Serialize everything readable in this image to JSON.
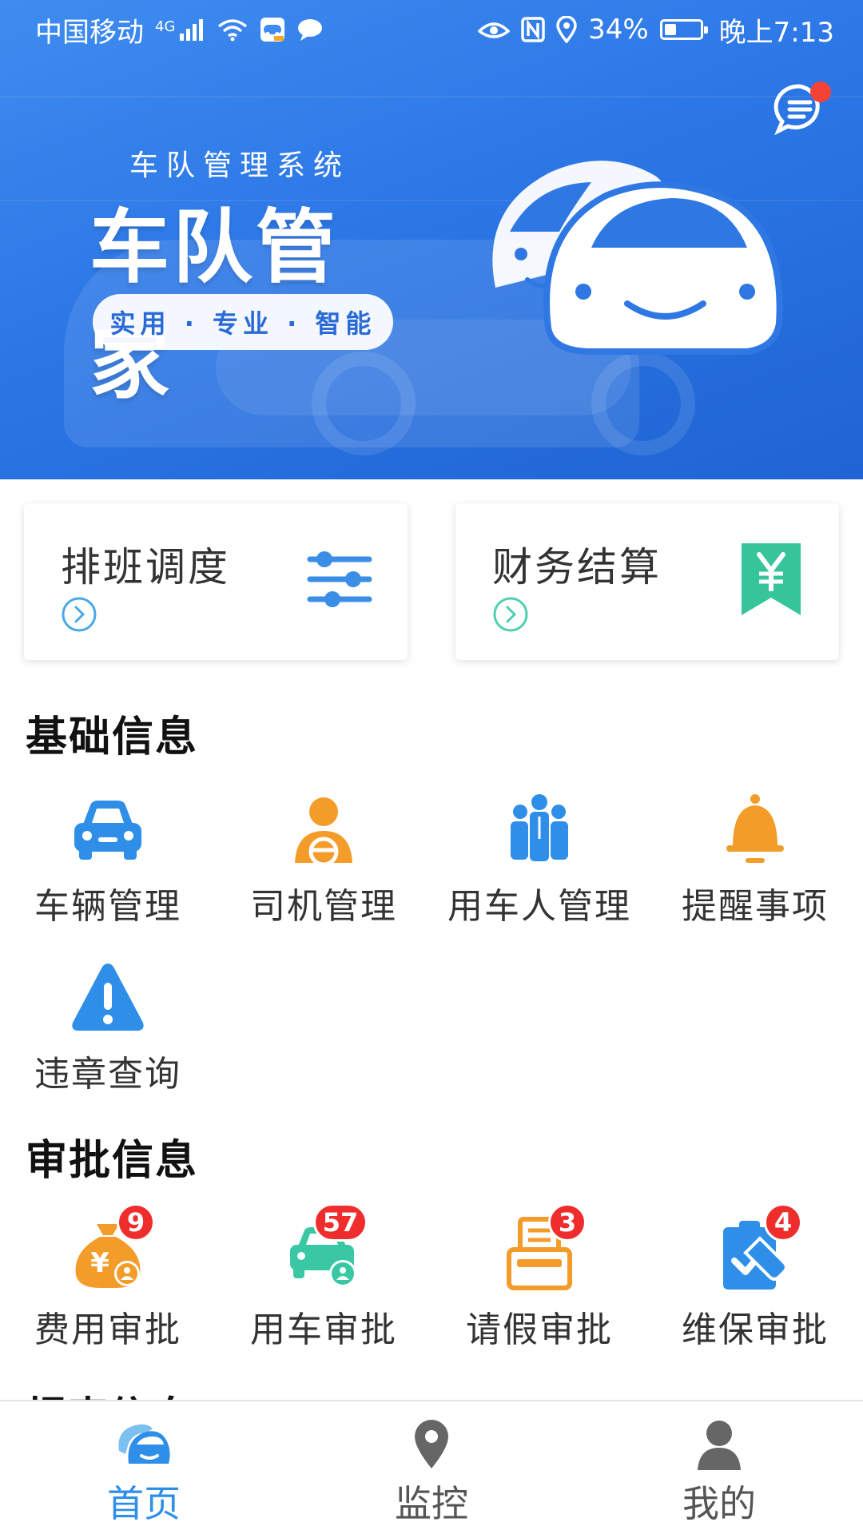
{
  "status_bar": {
    "carrier": "中国移动",
    "network": "4G",
    "battery": "34%",
    "battery_level": 0.34,
    "time": "晚上7:13",
    "icons": [
      "signal-icon",
      "wifi-icon",
      "app-notification-icon",
      "chat-bubble-icon",
      "eye-icon",
      "nfc-icon",
      "location-icon",
      "battery-icon"
    ]
  },
  "banner": {
    "subtitle": "车队管理系统",
    "title": "车队管家",
    "tagline": "实用 · 专业 · 智能",
    "message_icon": "message-list-icon",
    "has_unread": true,
    "accent_color": "#2a74e2"
  },
  "quick_cards": [
    {
      "label": "排班调度",
      "icon": "sliders-icon",
      "icon_color": "#3a8ee6"
    },
    {
      "label": "财务结算",
      "icon": "yuan-bookmark-icon",
      "icon_color": "#36c59a"
    }
  ],
  "basic_info": {
    "title": "基础信息",
    "items": [
      {
        "label": "车辆管理",
        "icon": "car-icon"
      },
      {
        "label": "司机管理",
        "icon": "driver-icon"
      },
      {
        "label": "用车人管理",
        "icon": "people-icon"
      },
      {
        "label": "提醒事项",
        "icon": "bell-icon"
      },
      {
        "label": "违章查询",
        "icon": "warning-icon"
      }
    ]
  },
  "approval_info": {
    "title": "审批信息",
    "items": [
      {
        "label": "费用审批",
        "icon": "money-bag-icon",
        "badge": "9"
      },
      {
        "label": "用车审批",
        "icon": "car-user-icon",
        "badge": "57"
      },
      {
        "label": "请假审批",
        "icon": "leave-form-icon",
        "badge": "3"
      },
      {
        "label": "维保审批",
        "icon": "maintenance-icon",
        "badge": "4"
      }
    ]
  },
  "next_section": {
    "title": "报表信息"
  },
  "tab_bar": {
    "active_color": "#2f8fe8",
    "tabs": [
      {
        "label": "首页",
        "icon": "home-car-icon",
        "active": true
      },
      {
        "label": "监控",
        "icon": "location-pin-icon",
        "active": false
      },
      {
        "label": "我的",
        "icon": "user-icon",
        "active": false
      }
    ]
  }
}
